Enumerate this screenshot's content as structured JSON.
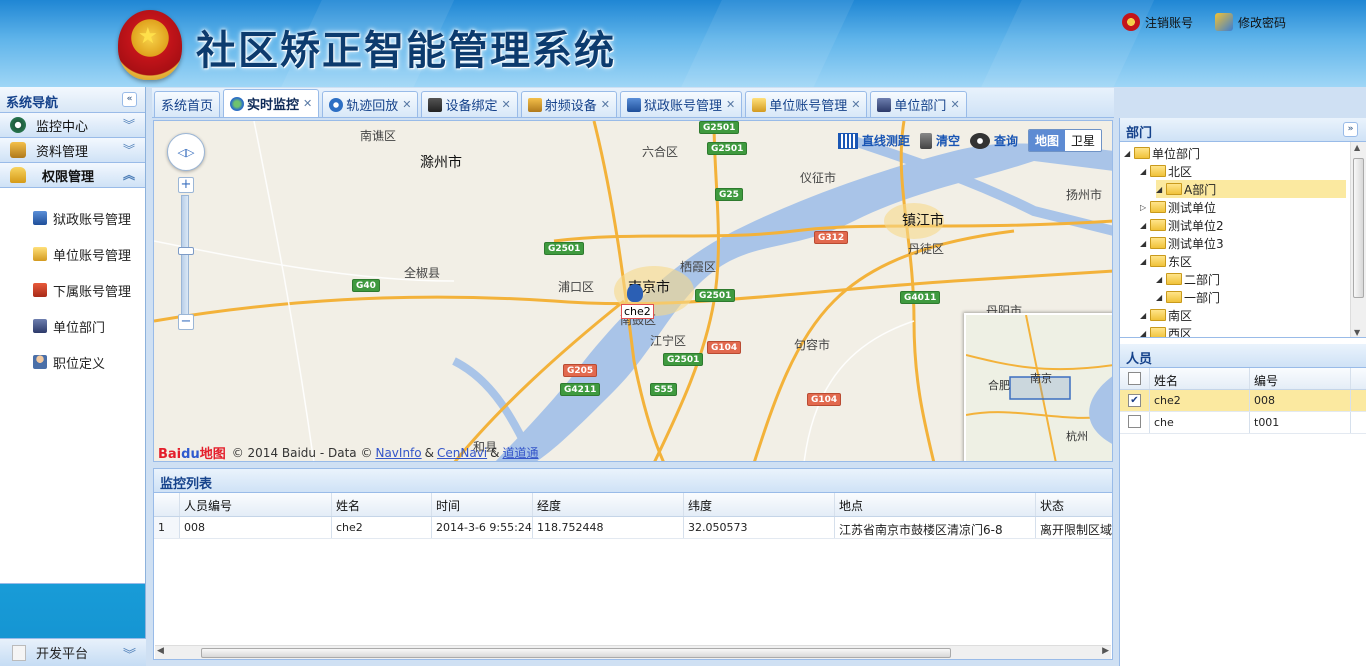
{
  "header": {
    "title": "社区矫正智能管理系统",
    "logout_label": "注销账号",
    "change_password_label": "修改密码"
  },
  "sidebar": {
    "title": "系统导航",
    "sections": [
      {
        "label": "监控中心"
      },
      {
        "label": "资料管理"
      },
      {
        "label": "权限管理"
      }
    ],
    "items": [
      {
        "label": "狱政账号管理"
      },
      {
        "label": "单位账号管理"
      },
      {
        "label": "下属账号管理"
      },
      {
        "label": "单位部门"
      },
      {
        "label": "职位定义"
      }
    ],
    "bottom_section": "开发平台"
  },
  "tabs": [
    {
      "label": "系统首页",
      "closable": false
    },
    {
      "label": "实时监控",
      "closable": true,
      "active": true
    },
    {
      "label": "轨迹回放",
      "closable": true
    },
    {
      "label": "设备绑定",
      "closable": true
    },
    {
      "label": "射频设备",
      "closable": true
    },
    {
      "label": "狱政账号管理",
      "closable": true
    },
    {
      "label": "单位账号管理",
      "closable": true
    },
    {
      "label": "单位部门",
      "closable": true
    }
  ],
  "map": {
    "tools": {
      "measure": "直线测距",
      "clear": "清空",
      "query": "查询"
    },
    "map_types": {
      "map": "地图",
      "satellite": "卫星"
    },
    "labels": {
      "nanqiao": "南谯区",
      "chuzhou": "滁州市",
      "liuhe": "六合区",
      "yizheng": "仪征市",
      "yangzhou": "扬州市",
      "zhenjiang": "镇江市",
      "dantu": "丹徒区",
      "quanjiao": "全椒县",
      "pukou": "浦口区",
      "nanjing": "南京市",
      "qixia": "栖霞区",
      "jiangning": "江宁区",
      "jurong": "句容市",
      "danyang": "丹阳市",
      "he": "和县",
      "gulou_partial": "南鼓区"
    },
    "roads": [
      "G2501",
      "G2501",
      "G25",
      "G312",
      "G2501",
      "G40",
      "G2501",
      "G4011",
      "G104",
      "G2501",
      "G205",
      "G4211",
      "S55",
      "G104"
    ],
    "marker_label": "che2",
    "minimap": {
      "hefei": "合肥",
      "nanjing": "南京",
      "hangzhou": "杭州"
    },
    "copyright": {
      "logo": "Bai",
      "logo_du": "du",
      "logo_map": "地图",
      "text": "© 2014 Baidu - Data ©",
      "navinfo": "NavInfo",
      "amp1": "&",
      "cennavi": "CenNavi",
      "amp2": "&",
      "daodao": "道道通"
    }
  },
  "monitor": {
    "title": "监控列表",
    "columns": [
      "人员编号",
      "姓名",
      "时间",
      "经度",
      "纬度",
      "地点",
      "状态"
    ],
    "rows": [
      {
        "index": "1",
        "id": "008",
        "name": "che2",
        "time": "2014-3-6 9:55:24",
        "lng": "118.752448",
        "lat": "32.050573",
        "place": "江苏省南京市鼓楼区清凉门6-8",
        "status": "离开限制区域"
      }
    ]
  },
  "dept_panel": {
    "title": "部门",
    "tree": [
      {
        "label": "单位部门"
      },
      {
        "label": "北区"
      },
      {
        "label": "A部门"
      },
      {
        "label": "测试单位"
      },
      {
        "label": "测试单位2"
      },
      {
        "label": "测试单位3"
      },
      {
        "label": "东区"
      },
      {
        "label": "二部门"
      },
      {
        "label": "一部门"
      },
      {
        "label": "南区"
      },
      {
        "label": "西区"
      }
    ]
  },
  "people_panel": {
    "title": "人员",
    "columns": [
      "姓名",
      "编号"
    ],
    "rows": [
      {
        "name": "che2",
        "id": "008",
        "checked": true
      },
      {
        "name": "che",
        "id": "t001",
        "checked": false
      }
    ]
  }
}
